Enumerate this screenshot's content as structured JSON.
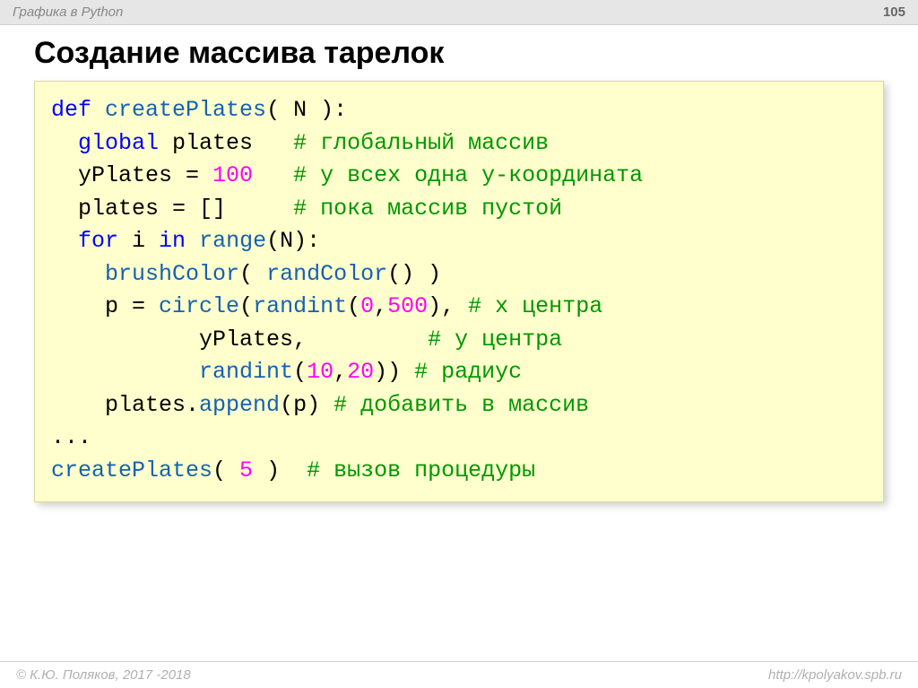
{
  "header": {
    "chapter": "Графика в Python",
    "page": "105"
  },
  "title": "Создание массива тарелок",
  "code": {
    "l1": {
      "kw_def": "def",
      "fn": "createPlates",
      "args": "( N ):"
    },
    "l2": {
      "kw_global": "global",
      "rest": " plates   ",
      "cm": "# глобальный массив"
    },
    "l3": {
      "lhs": "yPlates = ",
      "num": "100",
      "pad": "   ",
      "cm": "# у всех одна y-координата"
    },
    "l4": {
      "text": "plates = []     ",
      "cm": "# пока массив пустой"
    },
    "l5": {
      "kw_for": "for",
      "mid1": " i ",
      "kw_in": "in",
      "mid2": " ",
      "fn": "range",
      "rest": "(N):"
    },
    "l6": {
      "fn1": "brushColor",
      "mid": "( ",
      "fn2": "randColor",
      "rest": "() )"
    },
    "l7": {
      "pre": "p = ",
      "fn1": "circle",
      "p1": "(",
      "fn2": "randint",
      "p2": "(",
      "n1": "0",
      "comma": ",",
      "n2": "500",
      "p3": "), ",
      "cm": "# x центра"
    },
    "l8": {
      "pad": "           yPlates,         ",
      "cm": "# y центра"
    },
    "l9": {
      "pad": "           ",
      "fn": "randint",
      "p1": "(",
      "n1": "10",
      "c": ",",
      "n2": "20",
      "p2": ")) ",
      "cm": "# радиус"
    },
    "l10": {
      "pre": "plates.",
      "fn": "append",
      "rest": "(p) ",
      "cm": "# добавить в массив"
    },
    "l11": {
      "dots": "..."
    },
    "l12": {
      "fn": "createPlates",
      "args": "( ",
      "num": "5",
      "rest": " )  ",
      "cm": "# вызов процедуры"
    }
  },
  "footer": {
    "copyright": "© К.Ю. Поляков, 2017 -2018",
    "url": "http://kpolyakov.spb.ru"
  }
}
